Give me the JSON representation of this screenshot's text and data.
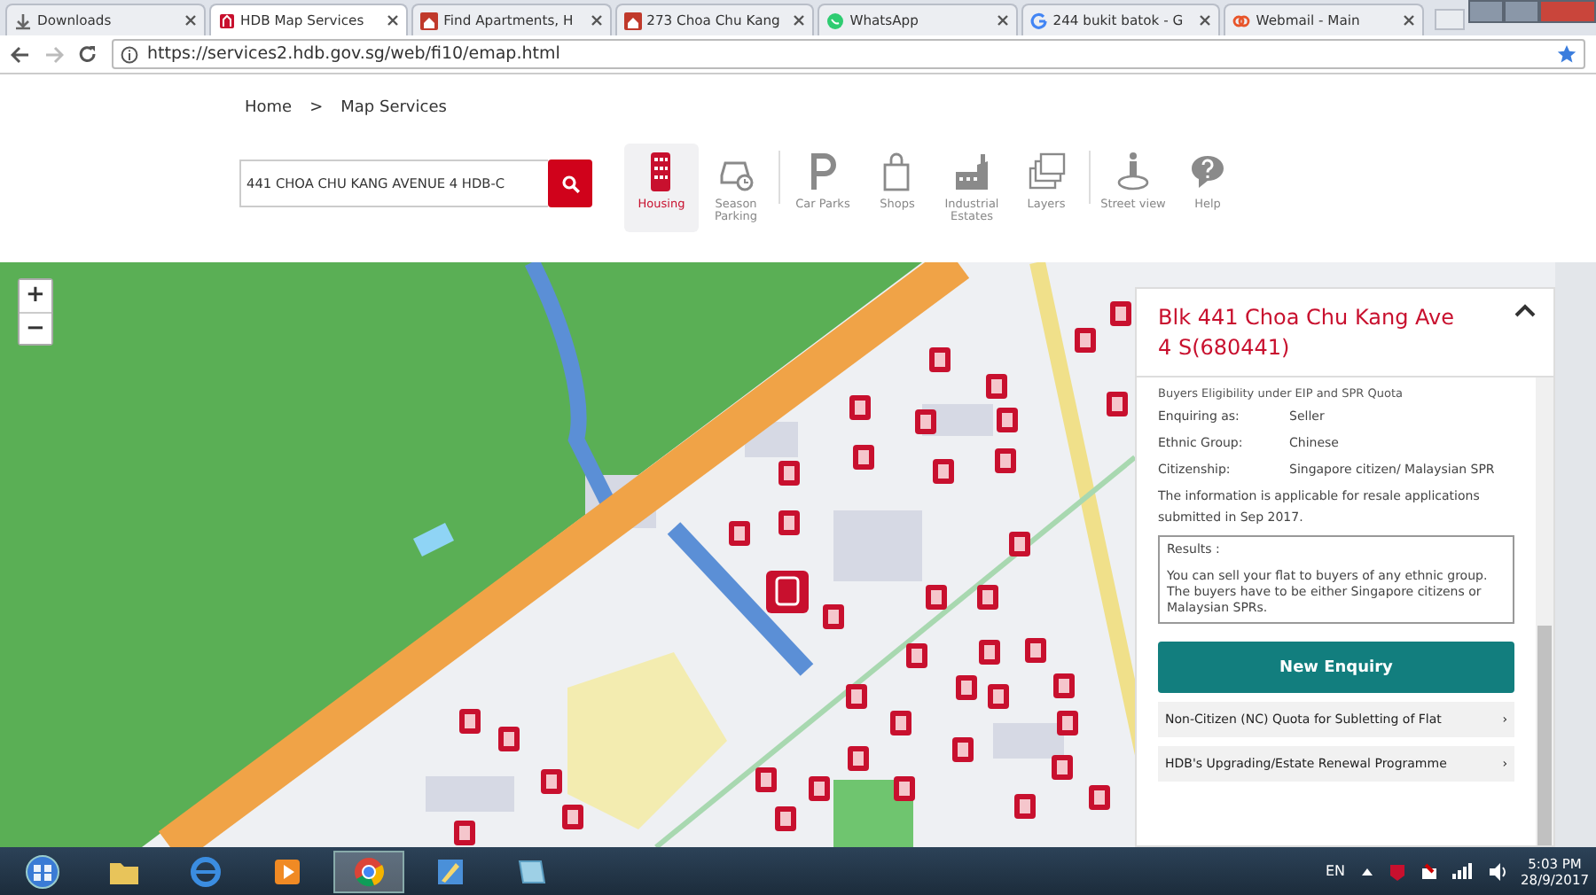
{
  "browser": {
    "tabs": [
      {
        "title": "Downloads",
        "kind": "download",
        "selected": false
      },
      {
        "title": "HDB Map Services",
        "kind": "hdb",
        "selected": true
      },
      {
        "title": "Find Apartments, H",
        "kind": "house",
        "selected": false
      },
      {
        "title": "273 Choa Chu Kang",
        "kind": "house",
        "selected": false
      },
      {
        "title": "WhatsApp",
        "kind": "chat",
        "selected": false
      },
      {
        "title": "244 bukit batok - G",
        "kind": "google",
        "selected": false
      },
      {
        "title": "Webmail - Main",
        "kind": "mail",
        "selected": false
      }
    ],
    "url": "https://services2.hdb.gov.sg/web/fi10/emap.html"
  },
  "breadcrumb": {
    "items": [
      "Home",
      "Map Services"
    ],
    "separator": ">"
  },
  "search": {
    "value": "441 CHOA CHU KANG AVENUE 4 HDB-C"
  },
  "tools": [
    {
      "label": "Housing",
      "kind": "housing",
      "selected": true
    },
    {
      "label": "Season Parking",
      "kind": "car",
      "selected": false
    },
    {
      "label": "Car Parks",
      "kind": "parking",
      "selected": false
    },
    {
      "label": "Shops",
      "kind": "bag",
      "selected": false
    },
    {
      "label": "Industrial Estates",
      "kind": "factory",
      "selected": false
    },
    {
      "label": "Layers",
      "kind": "layers",
      "selected": false
    },
    {
      "label": "Street view",
      "kind": "person",
      "selected": false
    },
    {
      "label": "Help",
      "kind": "help",
      "selected": false
    }
  ],
  "map": {
    "zoom_in": "+",
    "zoom_out": "−"
  },
  "panel": {
    "title": "Blk 441 Choa Chu Kang Ave 4 S(680441)",
    "expanded": true,
    "subtitle": "Buyers Eligibility under EIP and SPR Quota",
    "fields": [
      {
        "label": "Enquiring as:",
        "value": "Seller"
      },
      {
        "label": "Ethnic Group:",
        "value": "Chinese"
      },
      {
        "label": "Citizenship:",
        "value": "Singapore citizen/ Malaysian SPR"
      }
    ],
    "note": "The information is applicable for resale applications submitted in Sep 2017.",
    "results": {
      "label": "Results :",
      "text": "You can sell your flat to buyers of any ethnic group. The buyers have to be either Singapore citizens or Malaysian SPRs."
    },
    "button": "New Enquiry",
    "links": [
      {
        "label": "Non-Citizen (NC) Quota for Subletting of Flat",
        "arrow": "›"
      },
      {
        "label": "HDB's Upgrading/Estate Renewal Programme",
        "arrow": "›"
      }
    ]
  },
  "taskbar": {
    "items": [
      {
        "kind": "start",
        "selected": false
      },
      {
        "kind": "folder",
        "selected": false
      },
      {
        "kind": "ie",
        "selected": false
      },
      {
        "kind": "media",
        "selected": false
      },
      {
        "kind": "chrome",
        "selected": true
      },
      {
        "kind": "app",
        "selected": false
      },
      {
        "kind": "notes",
        "selected": false
      }
    ],
    "language": "EN",
    "time": "5:03 PM",
    "date": "28/9/2017"
  }
}
